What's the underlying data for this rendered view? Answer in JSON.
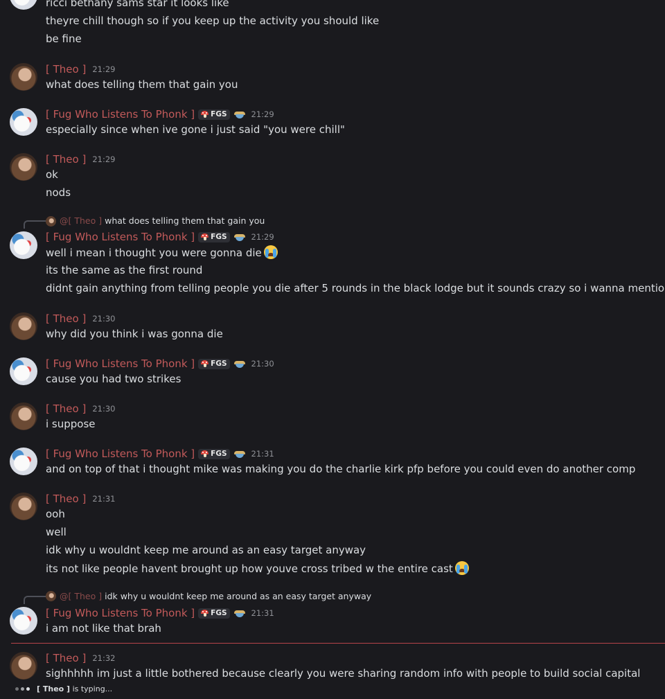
{
  "users": {
    "theo": "[ Theo ]",
    "fug": "[ Fug Who Listens To Phonk ]",
    "fug_tag": "FGS"
  },
  "messages": [
    {
      "lines": [
        "ricci bethany sams star it looks like",
        "theyre chill though so if you keep up the activity you should like",
        "be fine"
      ]
    },
    {
      "time": "21:29",
      "lines": [
        "what does telling them that gain you"
      ]
    },
    {
      "time": "21:29",
      "lines": [
        "especially since when ive gone i just said \"you were chill\""
      ]
    },
    {
      "time": "21:29",
      "lines": [
        "ok",
        "nods"
      ]
    },
    {
      "reply_mention": "@[ Theo ]",
      "reply_text": "what does telling them that gain you",
      "time": "21:29",
      "lines": [
        "well i mean i thought you were gonna die",
        "its the same as the first round",
        "didnt gain anything from telling people you die after 5 rounds in the black lodge but it sounds crazy so i wanna mention it"
      ]
    },
    {
      "time": "21:30",
      "lines": [
        "why did you think i was gonna die"
      ]
    },
    {
      "time": "21:30",
      "lines": [
        "cause you had two strikes"
      ]
    },
    {
      "time": "21:30",
      "lines": [
        "i suppose"
      ]
    },
    {
      "time": "21:31",
      "lines": [
        "and on top of that i thought mike was making you do the charlie kirk pfp before you could even do another comp"
      ]
    },
    {
      "time": "21:31",
      "lines": [
        "ooh",
        "well",
        "idk why u wouldnt keep me around as an easy target anyway",
        "its not like people havent brought up how youve cross tribed w the entire cast"
      ]
    },
    {
      "reply_mention": "@[ Theo ]",
      "reply_text": "idk why u wouldnt keep me around as an easy target anyway",
      "time": "21:31",
      "lines": [
        "i am not like that brah"
      ]
    },
    {
      "time": "21:32",
      "lines": [
        "sighhhhh im just a little bothered because clearly you were sharing random info with people to build social capital"
      ]
    }
  ],
  "typing": {
    "user": "[ Theo ]",
    "suffix": " is typing..."
  },
  "icons": {
    "emoji": "loudly-crying-face",
    "tag_icon": "mushroom",
    "role_icon": "ramen-bowl"
  },
  "colors": {
    "background": "#1a1a1e",
    "username": "#c25a5a",
    "divider": "#b8454a",
    "text": "#dbdee1"
  }
}
